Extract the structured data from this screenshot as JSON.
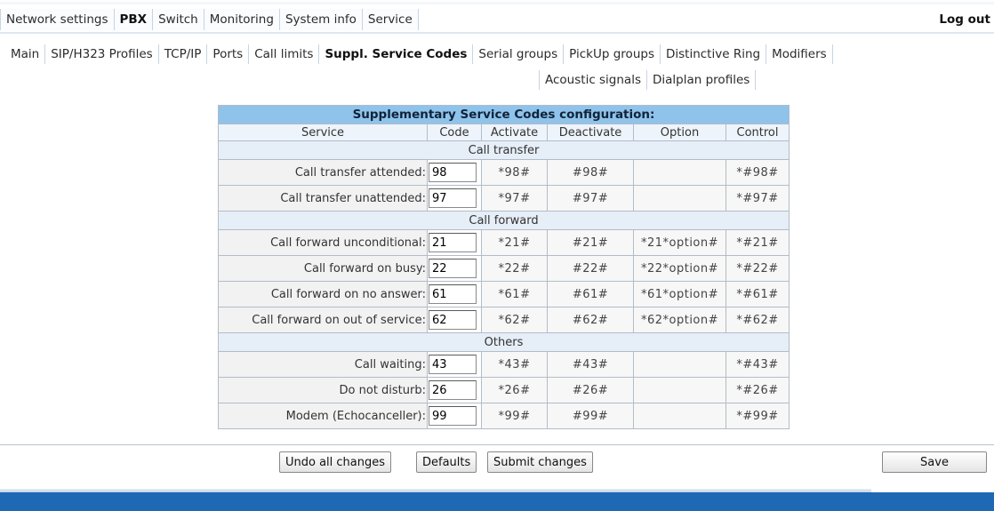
{
  "top_menu": {
    "items": [
      {
        "label": "Network settings",
        "active": false
      },
      {
        "label": "PBX",
        "active": true
      },
      {
        "label": "Switch",
        "active": false
      },
      {
        "label": "Monitoring",
        "active": false
      },
      {
        "label": "System info",
        "active": false
      },
      {
        "label": "Service",
        "active": false
      }
    ],
    "logout_label": "Log out"
  },
  "sub_menu": {
    "items": [
      {
        "label": "Main",
        "active": false
      },
      {
        "label": "SIP/H323 Profiles",
        "active": false
      },
      {
        "label": "TCP/IP",
        "active": false
      },
      {
        "label": "Ports",
        "active": false
      },
      {
        "label": "Call limits",
        "active": false
      },
      {
        "label": "Suppl. Service Codes",
        "active": true
      },
      {
        "label": "Serial groups",
        "active": false
      },
      {
        "label": "PickUp groups",
        "active": false
      },
      {
        "label": "Distinctive Ring",
        "active": false
      },
      {
        "label": "Modifiers",
        "active": false
      }
    ],
    "items_row2": [
      {
        "label": "Acoustic signals",
        "active": false
      },
      {
        "label": "Dialplan profiles",
        "active": false
      }
    ]
  },
  "table": {
    "title": "Supplementary Service Codes configuration:",
    "headers": {
      "service": "Service",
      "code": "Code",
      "activate": "Activate",
      "deactivate": "Deactivate",
      "option": "Option",
      "control": "Control"
    },
    "sections": [
      {
        "name": "Call transfer",
        "rows": [
          {
            "service": "Call transfer attended:",
            "code": "98",
            "activate": "*98#",
            "deactivate": "#98#",
            "option": "",
            "control": "*#98#"
          },
          {
            "service": "Call transfer unattended:",
            "code": "97",
            "activate": "*97#",
            "deactivate": "#97#",
            "option": "",
            "control": "*#97#"
          }
        ]
      },
      {
        "name": "Call forward",
        "rows": [
          {
            "service": "Call forward unconditional:",
            "code": "21",
            "activate": "*21#",
            "deactivate": "#21#",
            "option": "*21*option#",
            "control": "*#21#"
          },
          {
            "service": "Call forward on busy:",
            "code": "22",
            "activate": "*22#",
            "deactivate": "#22#",
            "option": "*22*option#",
            "control": "*#22#"
          },
          {
            "service": "Call forward on no answer:",
            "code": "61",
            "activate": "*61#",
            "deactivate": "#61#",
            "option": "*61*option#",
            "control": "*#61#"
          },
          {
            "service": "Call forward on out of service:",
            "code": "62",
            "activate": "*62#",
            "deactivate": "#62#",
            "option": "*62*option#",
            "control": "*#62#"
          }
        ]
      },
      {
        "name": "Others",
        "rows": [
          {
            "service": "Call waiting:",
            "code": "43",
            "activate": "*43#",
            "deactivate": "#43#",
            "option": "",
            "control": "*#43#"
          },
          {
            "service": "Do not disturb:",
            "code": "26",
            "activate": "*26#",
            "deactivate": "#26#",
            "option": "",
            "control": "*#26#"
          },
          {
            "service": "Modem (Echocanceller):",
            "code": "99",
            "activate": "*99#",
            "deactivate": "#99#",
            "option": "",
            "control": "*#99#"
          }
        ]
      }
    ]
  },
  "buttons": {
    "undo": "Undo all changes",
    "defaults": "Defaults",
    "submit": "Submit changes",
    "save": "Save"
  },
  "colors": {
    "title_bar": "#8fc3ea",
    "footer_band": "#1f68b4"
  }
}
